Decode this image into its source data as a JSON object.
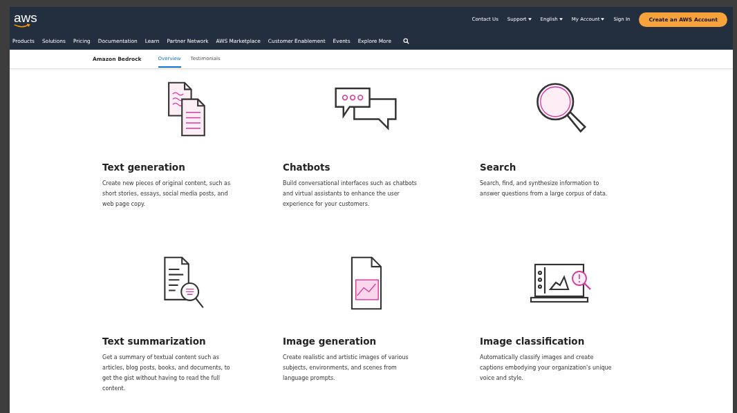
{
  "header": {
    "logo": "aws",
    "utility_links": [
      {
        "label": "Contact Us",
        "dropdown": false
      },
      {
        "label": "Support",
        "dropdown": true
      },
      {
        "label": "English",
        "dropdown": true
      },
      {
        "label": "My Account",
        "dropdown": true
      },
      {
        "label": "Sign In",
        "dropdown": false
      }
    ],
    "cta": "Create an AWS Account"
  },
  "nav": [
    "Products",
    "Solutions",
    "Pricing",
    "Documentation",
    "Learn",
    "Partner Network",
    "AWS Marketplace",
    "Customer Enablement",
    "Events",
    "Explore More"
  ],
  "subnav": {
    "title": "Amazon Bedrock",
    "tabs": [
      {
        "label": "Overview",
        "selected": true
      },
      {
        "label": "Testimonials",
        "selected": false
      }
    ]
  },
  "cards": [
    {
      "title": "Text generation",
      "description": "Create new pieces of original content, such as short stories, essays, social media posts, and web page copy."
    },
    {
      "title": "Chatbots",
      "description": "Build conversational interfaces such as chatbots and virtual assistants to enhance the user experience for your customers."
    },
    {
      "title": "Search",
      "description": "Search, find, and synthesize information to answer questions from a large corpus of data."
    },
    {
      "title": "Text summarization",
      "description": "Get a summary of textual content such as articles, blog posts, books, and documents, to get the gist without having to read the full content."
    },
    {
      "title": "Image generation",
      "description": "Create realistic and artistic images of various subjects, environments, and scenes from language prompts."
    },
    {
      "title": "Image classification",
      "description": "Automatically classify images and create captions embodying your organization's unique voice and style."
    }
  ]
}
